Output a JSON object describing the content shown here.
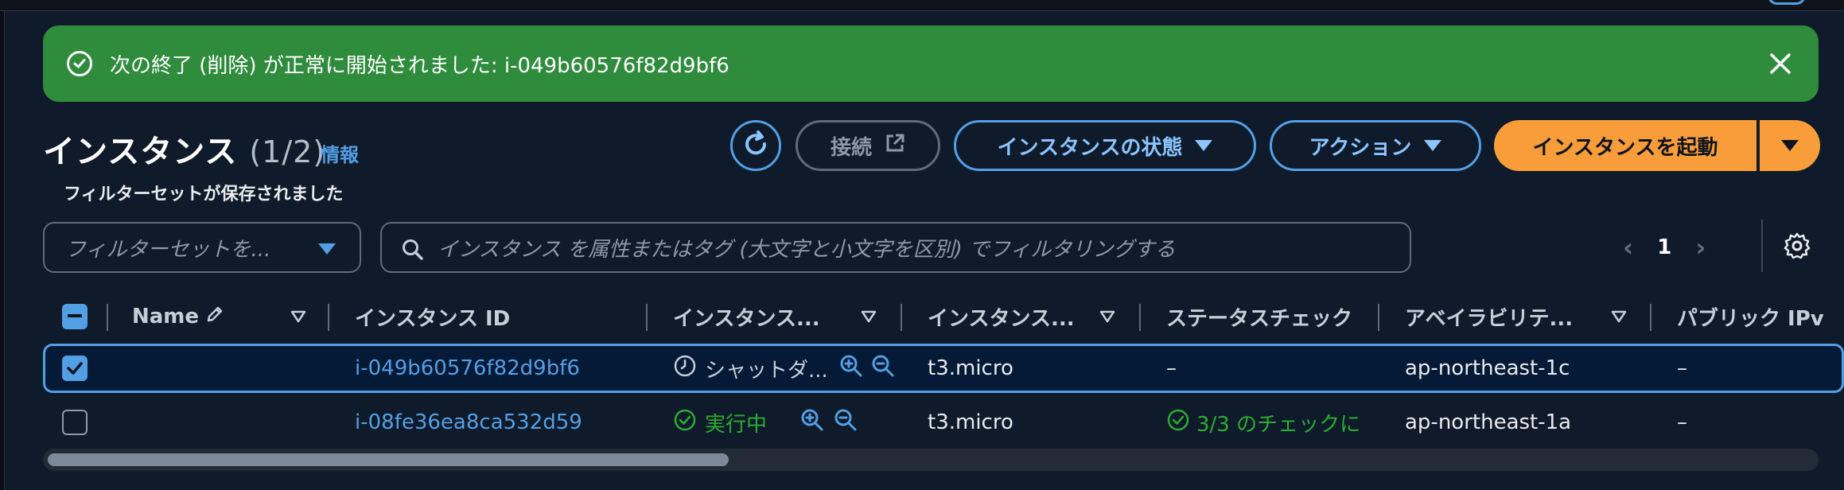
{
  "flash": {
    "message": "次の終了 (削除) が正常に開始されました: i-049b60576f82d9bf6"
  },
  "header": {
    "title": "インスタンス",
    "count": "(1/2)",
    "info_link": "情報",
    "connect_label": "接続",
    "instance_state_label": "インスタンスの状態",
    "actions_label": "アクション",
    "launch_label": "インスタンスを起動"
  },
  "filters": {
    "saved_label": "フィルターセットが保存されました",
    "saved_placeholder": "フィルターセットを...",
    "search_placeholder": "インスタンス を属性またはタグ (大文字と小文字を区別) でフィルタリングする"
  },
  "pagination": {
    "current_page": "1"
  },
  "table": {
    "columns": [
      "Name",
      "インスタンス ID",
      "インスタンス...",
      "インスタンス...",
      "ステータスチェック",
      "アベイラビリテ...",
      "パブリック IPv"
    ],
    "rows": [
      {
        "selected": true,
        "name": "",
        "instance_id": "i-049b60576f82d9bf6",
        "state": "シャットダ...",
        "type": "t3.micro",
        "status_check": "–",
        "az": "ap-northeast-1c",
        "public_ip": "–"
      },
      {
        "selected": false,
        "name": "",
        "instance_id": "i-08fe36ea8ca532d59",
        "state": "実行中",
        "type": "t3.micro",
        "status_check": "3/3 のチェックに",
        "az": "ap-northeast-1a",
        "public_ip": "–"
      }
    ]
  },
  "colors": {
    "accent": "#539fe5",
    "success": "#2f8c3c",
    "primary_button": "#f89d3a",
    "background": "#0f1b2a"
  },
  "icons": {
    "flash": "check-circle-icon",
    "close": "close-icon",
    "refresh": "refresh-icon",
    "external": "external-link-icon",
    "search": "search-icon",
    "settings": "gear-icon",
    "edit": "pencil-icon",
    "clock": "clock-icon",
    "zoom_in": "zoom-in-icon",
    "zoom_out": "zoom-out-icon"
  }
}
